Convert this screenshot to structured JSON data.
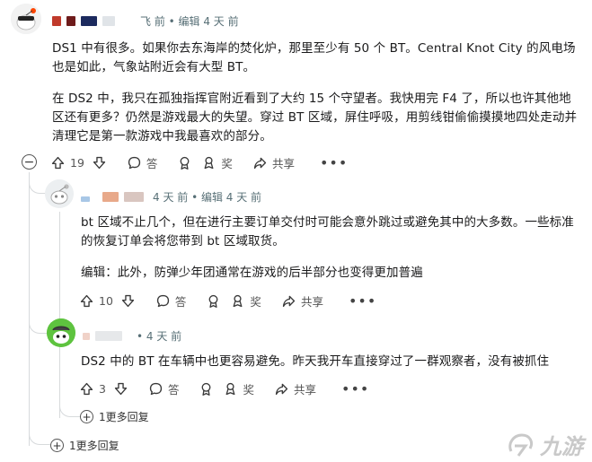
{
  "comments": [
    {
      "meta_time": "飞 前 • 编辑 4 天 前",
      "paragraphs": [
        "DS1 中有很多。如果你去东海岸的焚化炉，那里至少有 50 个 BT。Central Knot City 的风电场也是如此，气象站附近会有大型 BT。",
        "在 DS2 中，我只在孤独指挥官附近看到了大约 15 个守望者。我快用完 F4 了，所以也许其他地区还有更多？仍然是游戏最大的失望。穿过 BT 区域，屏住呼吸，用剪线钳偷偷摸摸地四处走动并清理它是第一款游戏中我最喜欢的部分。"
      ],
      "votes": "19",
      "reply_label": "答",
      "award_label": "奖",
      "share_label": "共享",
      "more_label": "•••"
    },
    {
      "meta_time": "4 天 前 • 编辑 4 天 前",
      "paragraphs": [
        "bt 区域不止几个，但在进行主要订单交付时可能会意外跳过或避免其中的大多数。一些标准的恢复订单会将您带到 bt 区域取货。",
        "编辑：此外，防弹少年团通常在游戏的后半部分也变得更加普遍"
      ],
      "votes": "10",
      "reply_label": "答",
      "award_label": "奖",
      "share_label": "共享",
      "more_label": "•••"
    },
    {
      "meta_time": "• 4 天 前",
      "paragraphs": [
        "DS2 中的 BT 在车辆中也更容易避免。昨天我开车直接穿过了一群观察者，没有被抓住"
      ],
      "votes": "3",
      "reply_label": "答",
      "award_label": "奖",
      "share_label": "共享",
      "more_label": "•••"
    }
  ],
  "more_replies_nested": "1更多回复",
  "more_replies_root": "1更多回复",
  "collapse_symbol": "−",
  "expand_symbol": "+",
  "watermark_text": "九游",
  "colors": {
    "redacted_red": "#c03a2b",
    "redacted_darkred": "#6e1b1b",
    "redacted_navy": "#1c2a5e",
    "redacted_peach": "#e8a98a",
    "avatar_green": "#5ec33f",
    "thread_line": "#d7dadc",
    "meta_text": "#576f76"
  }
}
